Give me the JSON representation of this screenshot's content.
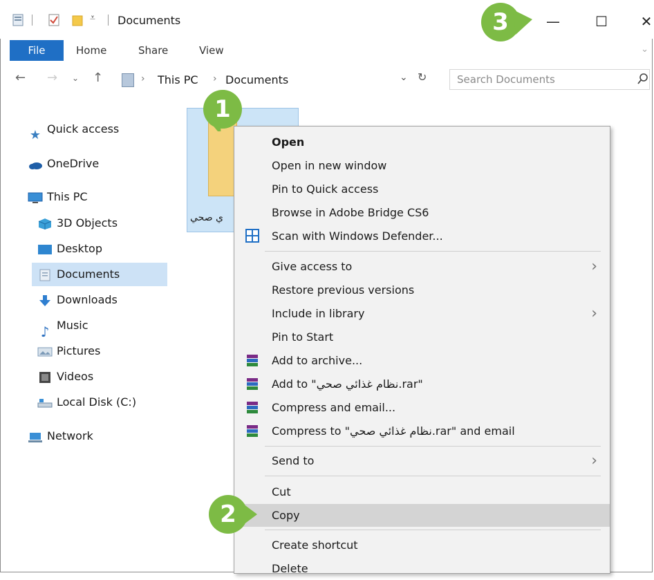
{
  "window": {
    "title": "Documents",
    "controls": {
      "minimize": "—",
      "maximize": "☐",
      "close": "✕"
    }
  },
  "ribbon": {
    "tabs": [
      "File",
      "Home",
      "Share",
      "View"
    ],
    "right_glyph": "⌄"
  },
  "address": {
    "breadcrumbs": [
      "This PC",
      "Documents"
    ],
    "dropdown_glyph": "⌄",
    "refresh_glyph": "↻",
    "search_placeholder": "Search Documents"
  },
  "navigation": {
    "items": [
      {
        "label": "Quick access",
        "icon": "star-icon",
        "color": "#3a7fc1"
      },
      {
        "label": "OneDrive",
        "icon": "cloud-icon",
        "color": "#1f5fa8"
      },
      {
        "label": "This PC",
        "icon": "computer-icon",
        "color": "#3a8fd6"
      },
      {
        "label": "3D Objects",
        "icon": "cube-icon",
        "color": "#3aa0d8"
      },
      {
        "label": "Desktop",
        "icon": "desktop-icon",
        "color": "#2e86d0"
      },
      {
        "label": "Documents",
        "icon": "document-icon",
        "color": "#9ab0c8",
        "selected": true
      },
      {
        "label": "Downloads",
        "icon": "download-icon",
        "color": "#2f7fd0"
      },
      {
        "label": "Music",
        "icon": "music-icon",
        "color": "#2a6fc0"
      },
      {
        "label": "Pictures",
        "icon": "pictures-icon",
        "color": "#7d9bb8"
      },
      {
        "label": "Videos",
        "icon": "video-icon",
        "color": "#444444"
      },
      {
        "label": "Local Disk (C:)",
        "icon": "disk-icon",
        "color": "#6b8aa5"
      },
      {
        "label": "Network",
        "icon": "network-icon",
        "color": "#3a8fd6"
      }
    ]
  },
  "file": {
    "name_fragment": "ي صحي"
  },
  "context_menu": {
    "items": [
      {
        "label": "Open",
        "bold": true
      },
      {
        "label": "Open in new window"
      },
      {
        "label": "Pin to Quick access"
      },
      {
        "label": "Browse in Adobe Bridge CS6"
      },
      {
        "label": "Scan with Windows Defender...",
        "icon": "defender-icon"
      },
      {
        "label": "Give access to",
        "submenu": true
      },
      {
        "label": "Restore previous versions"
      },
      {
        "label": "Include in library",
        "submenu": true
      },
      {
        "label": "Pin to Start"
      },
      {
        "label": "Add to archive...",
        "icon": "winrar-icon"
      },
      {
        "label": "Add to \"نظام غذائي صحي.rar\"",
        "icon": "winrar-icon"
      },
      {
        "label": "Compress and email...",
        "icon": "winrar-icon"
      },
      {
        "label": "Compress to \"نظام غذائي صحي.rar\" and email",
        "icon": "winrar-icon"
      },
      {
        "label": "Send to",
        "submenu": true
      },
      {
        "label": "Cut"
      },
      {
        "label": "Copy",
        "highlighted": true
      },
      {
        "label": "Create shortcut"
      },
      {
        "label": "Delete"
      }
    ],
    "submenu_glyph": "›"
  },
  "badges": [
    "1",
    "2",
    "3"
  ],
  "colors": {
    "badge_green": "#7dbb45",
    "file_tab_blue": "#1f6fc5",
    "selection_blue": "#cde2f6"
  }
}
